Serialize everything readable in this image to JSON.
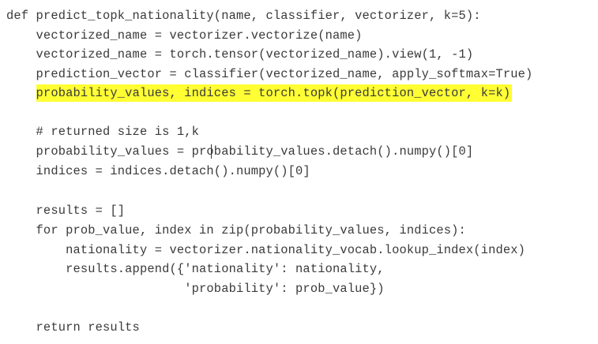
{
  "editor": {
    "highlight_color": "#ffff33",
    "text_color": "#3a3a3a",
    "lines": [
      {
        "text": "def predict_topk_nationality(name, classifier, vectorizer, k=5):"
      },
      {
        "text": "    vectorized_name = vectorizer.vectorize(name)"
      },
      {
        "text": "    vectorized_name = torch.tensor(vectorized_name).view(1, -1)"
      },
      {
        "text": "    prediction_vector = classifier(vectorized_name, apply_softmax=True)"
      },
      {
        "indent": "    ",
        "text": "probability_values, indices = torch.topk(prediction_vector, k=k)",
        "highlighted": true
      },
      {
        "text": ""
      },
      {
        "text": "    # returned size is 1,k"
      },
      {
        "text": "    probability_values = probability_values.detach().numpy()[0]"
      },
      {
        "text": "    indices = indices.detach().numpy()[0]"
      },
      {
        "text": ""
      },
      {
        "text": "    results = []"
      },
      {
        "text": "    for prob_value, index in zip(probability_values, indices):"
      },
      {
        "text": "        nationality = vectorizer.nationality_vocab.lookup_index(index)"
      },
      {
        "text": "        results.append({'nationality': nationality,"
      },
      {
        "text": "                        'probability': prob_value})"
      },
      {
        "text": ""
      },
      {
        "text": "    return results"
      }
    ]
  }
}
